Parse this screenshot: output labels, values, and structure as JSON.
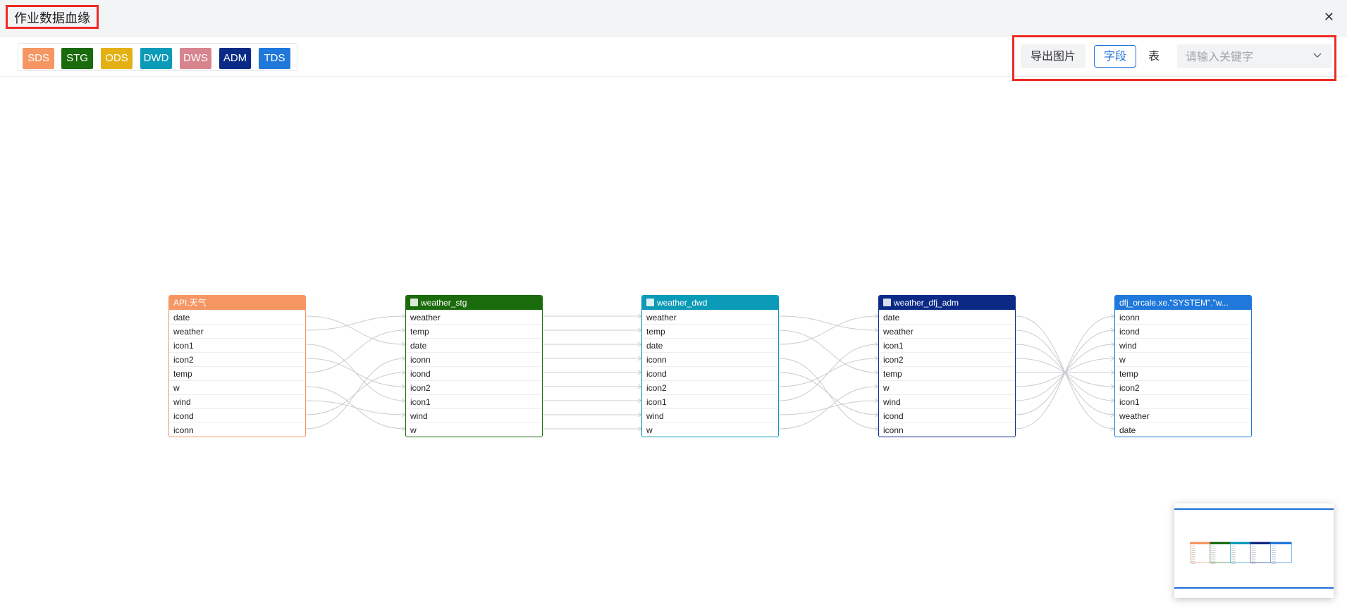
{
  "window": {
    "title": "作业数据血缘"
  },
  "legend": [
    {
      "label": "SDS",
      "color": "#f59663"
    },
    {
      "label": "STG",
      "color": "#1a6b0c"
    },
    {
      "label": "ODS",
      "color": "#e3b114"
    },
    {
      "label": "DWD",
      "color": "#0b9ab7"
    },
    {
      "label": "DWS",
      "color": "#d8848f"
    },
    {
      "label": "ADM",
      "color": "#0a2a86"
    },
    {
      "label": "TDS",
      "color": "#1f78da"
    }
  ],
  "toolbar": {
    "export_label": "导出图片",
    "mode_field": "字段",
    "mode_table": "表",
    "search_placeholder": "请输入关键字"
  },
  "nodes": [
    {
      "id": "api",
      "name": "API.天气",
      "layer": "SDS",
      "color": "#f59663",
      "icon": false,
      "fields": [
        "date",
        "weather",
        "icon1",
        "icon2",
        "temp",
        "w",
        "wind",
        "icond",
        "iconn"
      ]
    },
    {
      "id": "stg",
      "name": "weather_stg",
      "layer": "STG",
      "color": "#1a6b0c",
      "icon": true,
      "fields": [
        "weather",
        "temp",
        "date",
        "iconn",
        "icond",
        "icon2",
        "icon1",
        "wind",
        "w"
      ]
    },
    {
      "id": "dwd",
      "name": "weather_dwd",
      "layer": "DWD",
      "color": "#0b9ab7",
      "icon": true,
      "fields": [
        "weather",
        "temp",
        "date",
        "iconn",
        "icond",
        "icon2",
        "icon1",
        "wind",
        "w"
      ]
    },
    {
      "id": "adm",
      "name": "weather_dfj_adm",
      "layer": "ADM",
      "color": "#0a2a86",
      "icon": true,
      "fields": [
        "date",
        "weather",
        "icon1",
        "icon2",
        "temp",
        "w",
        "wind",
        "icond",
        "iconn"
      ]
    },
    {
      "id": "tds",
      "name": "dfj_orcale.xe.\"SYSTEM\".\"w...",
      "layer": "TDS",
      "color": "#1f78da",
      "icon": false,
      "fields": [
        "iconn",
        "icond",
        "wind",
        "w",
        "temp",
        "icon2",
        "icon1",
        "weather",
        "date"
      ]
    }
  ]
}
